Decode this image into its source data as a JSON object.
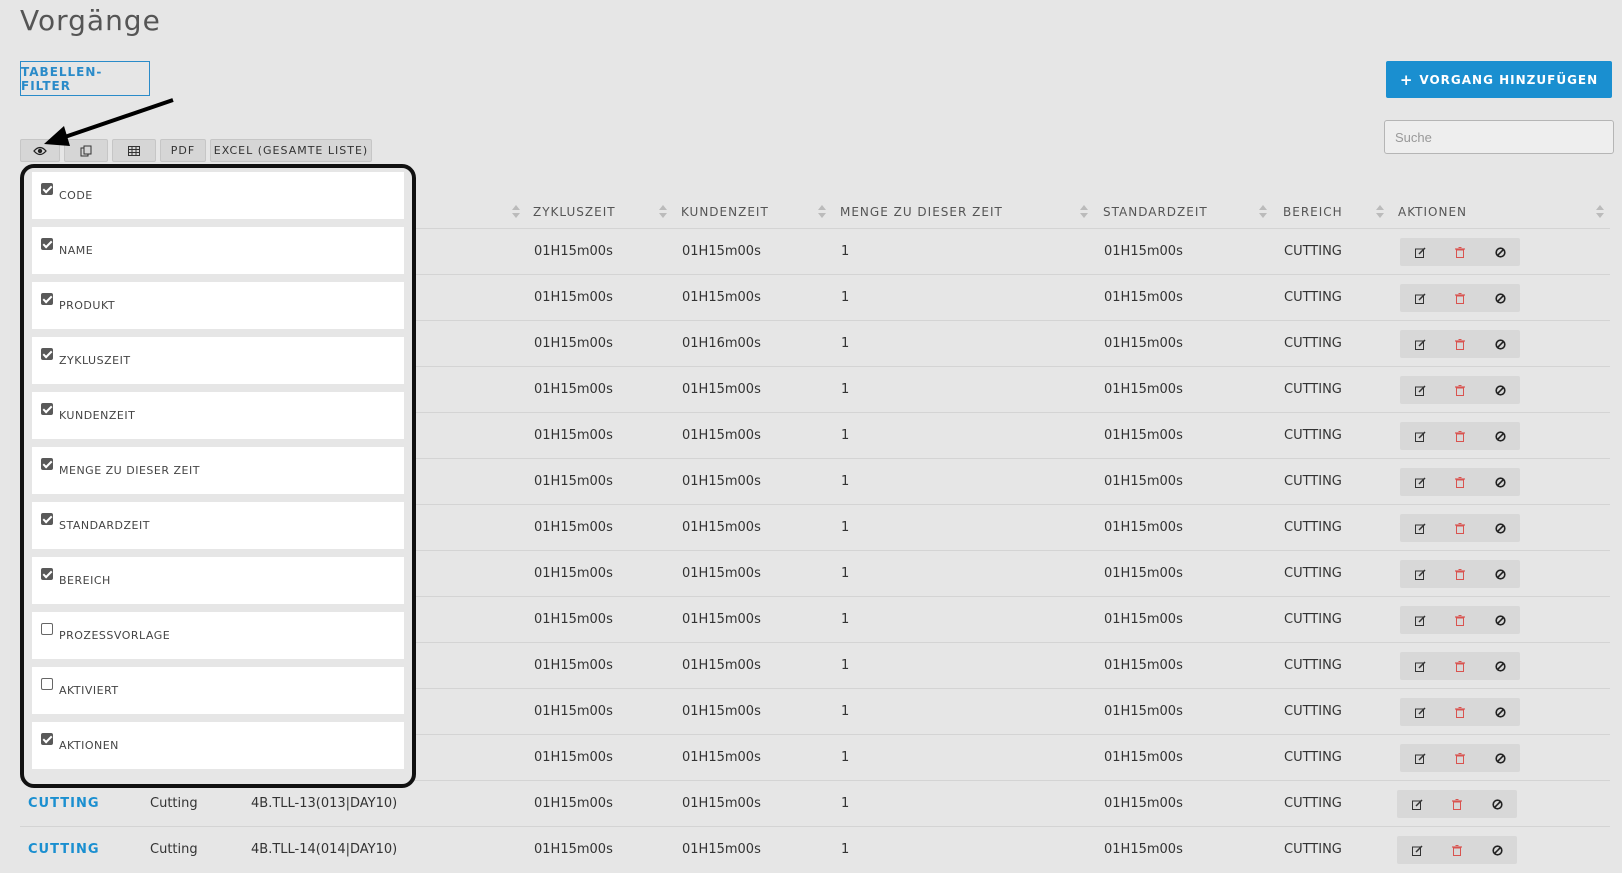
{
  "page": {
    "title": "Vorgänge"
  },
  "toolbar": {
    "filter_label": "TABELLEN-FILTER",
    "add_label": "VORGANG HINZUFÜGEN",
    "add_icon": "plus-icon",
    "search_placeholder": "Suche",
    "buttons": [
      {
        "icon": "eye-icon",
        "label": ""
      },
      {
        "icon": "copy-icon",
        "label": ""
      },
      {
        "icon": "table-icon",
        "label": ""
      },
      {
        "icon": "",
        "label": "PDF"
      },
      {
        "icon": "",
        "label": "EXCEL (GESAMTE LISTE)"
      }
    ]
  },
  "table": {
    "headers": [
      "ZYKLUSZEIT",
      "KUNDENZEIT",
      "MENGE ZU DIESER ZEIT",
      "STANDARDZEIT",
      "BEREICH",
      "AKTIONEN"
    ],
    "rows": [
      {
        "code": "",
        "name": "",
        "produkt": "",
        "zyklus": "01H15m00s",
        "kunden": "01H15m00s",
        "menge": "1",
        "standard": "01H15m00s",
        "bereich": "CUTTING"
      },
      {
        "code": "",
        "name": "",
        "produkt": "",
        "zyklus": "01H15m00s",
        "kunden": "01H15m00s",
        "menge": "1",
        "standard": "01H15m00s",
        "bereich": "CUTTING"
      },
      {
        "code": "",
        "name": "",
        "produkt": "",
        "zyklus": "01H15m00s",
        "kunden": "01H16m00s",
        "menge": "1",
        "standard": "01H15m00s",
        "bereich": "CUTTING"
      },
      {
        "code": "",
        "name": "",
        "produkt": "",
        "zyklus": "01H15m00s",
        "kunden": "01H15m00s",
        "menge": "1",
        "standard": "01H15m00s",
        "bereich": "CUTTING"
      },
      {
        "code": "",
        "name": "",
        "produkt": "",
        "zyklus": "01H15m00s",
        "kunden": "01H15m00s",
        "menge": "1",
        "standard": "01H15m00s",
        "bereich": "CUTTING"
      },
      {
        "code": "",
        "name": "",
        "produkt": "",
        "zyklus": "01H15m00s",
        "kunden": "01H15m00s",
        "menge": "1",
        "standard": "01H15m00s",
        "bereich": "CUTTING"
      },
      {
        "code": "",
        "name": "",
        "produkt": "",
        "zyklus": "01H15m00s",
        "kunden": "01H15m00s",
        "menge": "1",
        "standard": "01H15m00s",
        "bereich": "CUTTING"
      },
      {
        "code": "",
        "name": "",
        "produkt": "",
        "zyklus": "01H15m00s",
        "kunden": "01H15m00s",
        "menge": "1",
        "standard": "01H15m00s",
        "bereich": "CUTTING"
      },
      {
        "code": "",
        "name": "",
        "produkt": "",
        "zyklus": "01H15m00s",
        "kunden": "01H15m00s",
        "menge": "1",
        "standard": "01H15m00s",
        "bereich": "CUTTING"
      },
      {
        "code": "",
        "name": "",
        "produkt": "",
        "zyklus": "01H15m00s",
        "kunden": "01H15m00s",
        "menge": "1",
        "standard": "01H15m00s",
        "bereich": "CUTTING"
      },
      {
        "code": "",
        "name": "",
        "produkt": "",
        "zyklus": "01H15m00s",
        "kunden": "01H15m00s",
        "menge": "1",
        "standard": "01H15m00s",
        "bereich": "CUTTING"
      },
      {
        "code": "",
        "name": "",
        "produkt": "",
        "zyklus": "01H15m00s",
        "kunden": "01H15m00s",
        "menge": "1",
        "standard": "01H15m00s",
        "bereich": "CUTTING"
      },
      {
        "code": "CUTTING",
        "name": "Cutting",
        "produkt": "4B.TLL-13(013|DAY10)",
        "zyklus": "01H15m00s",
        "kunden": "01H15m00s",
        "menge": "1",
        "standard": "01H15m00s",
        "bereich": "CUTTING"
      },
      {
        "code": "CUTTING",
        "name": "Cutting",
        "produkt": "4B.TLL-14(014|DAY10)",
        "zyklus": "01H15m00s",
        "kunden": "01H15m00s",
        "menge": "1",
        "standard": "01H15m00s",
        "bereich": "CUTTING"
      }
    ]
  },
  "column_toggle": {
    "options": [
      {
        "label": "CODE",
        "checked": true
      },
      {
        "label": "NAME",
        "checked": true
      },
      {
        "label": "PRODUKT",
        "checked": true
      },
      {
        "label": "ZYKLUSZEIT",
        "checked": true
      },
      {
        "label": "KUNDENZEIT",
        "checked": true
      },
      {
        "label": "MENGE ZU DIESER ZEIT",
        "checked": true
      },
      {
        "label": "STANDARDZEIT",
        "checked": true
      },
      {
        "label": "BEREICH",
        "checked": true
      },
      {
        "label": "PROZESSVORLAGE",
        "checked": false
      },
      {
        "label": "AKTIVIERT",
        "checked": false
      },
      {
        "label": "AKTIONEN",
        "checked": true
      }
    ]
  },
  "colors": {
    "accent": "#1a8fd0",
    "delete": "#d9534f",
    "background": "#e6e6e6"
  }
}
